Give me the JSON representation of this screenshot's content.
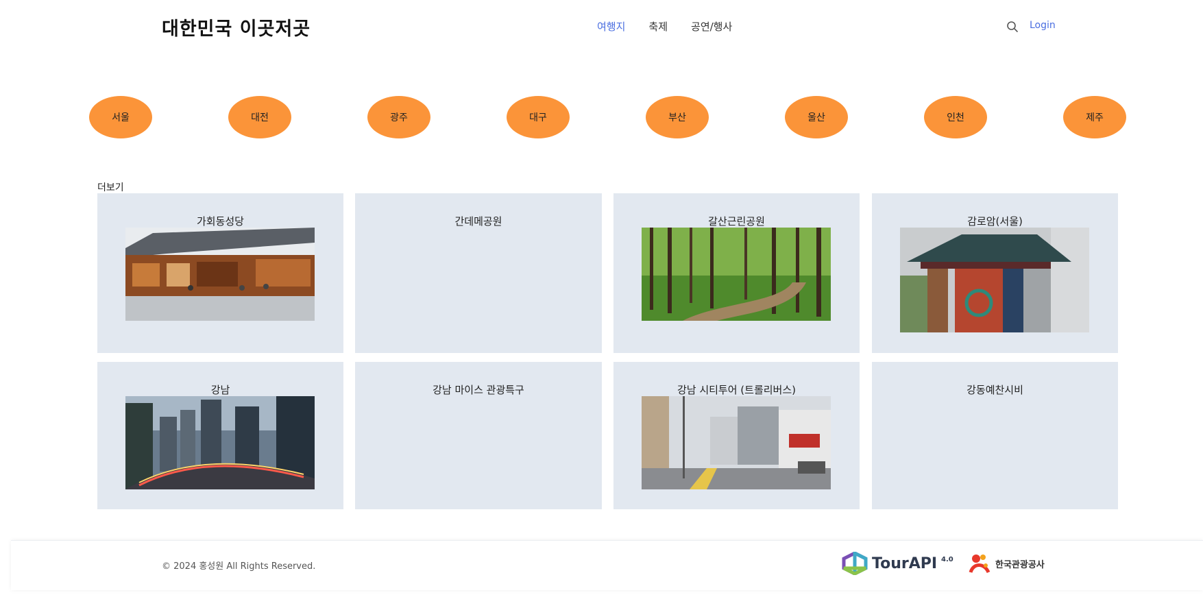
{
  "header": {
    "brand": "대한민국 이곳저곳",
    "nav": [
      {
        "label": "여행지",
        "active": true
      },
      {
        "label": "축제",
        "active": false
      },
      {
        "label": "공연/행사",
        "active": false
      }
    ],
    "login_label": "Login",
    "search_icon": "search-icon",
    "accent_color": "#4a6ee0"
  },
  "regions": {
    "items": [
      "서울",
      "대전",
      "광주",
      "대구",
      "부산",
      "울산",
      "인천",
      "제주"
    ],
    "color": "#fb9439"
  },
  "more_label": "더보기",
  "cards": [
    {
      "title": "가회동성당",
      "image": "hanok-courtyard"
    },
    {
      "title": "간데메공원",
      "image": ""
    },
    {
      "title": "갈산근린공원",
      "image": "forest-path"
    },
    {
      "title": "감로암(서울)",
      "image": "temple-gate"
    },
    {
      "title": "강남",
      "image": "city-night"
    },
    {
      "title": "강남 마이스 관광특구",
      "image": ""
    },
    {
      "title": "강남 시티투어 (트롤리버스)",
      "image": "street-view"
    },
    {
      "title": "강동예찬시비",
      "image": ""
    }
  ],
  "footer": {
    "copyright": "© 2024 홍성원 All Rights Reserved.",
    "tourapi_label": "TourAPI",
    "tourapi_version": "4.0",
    "kto_label": "한국관광공사"
  }
}
